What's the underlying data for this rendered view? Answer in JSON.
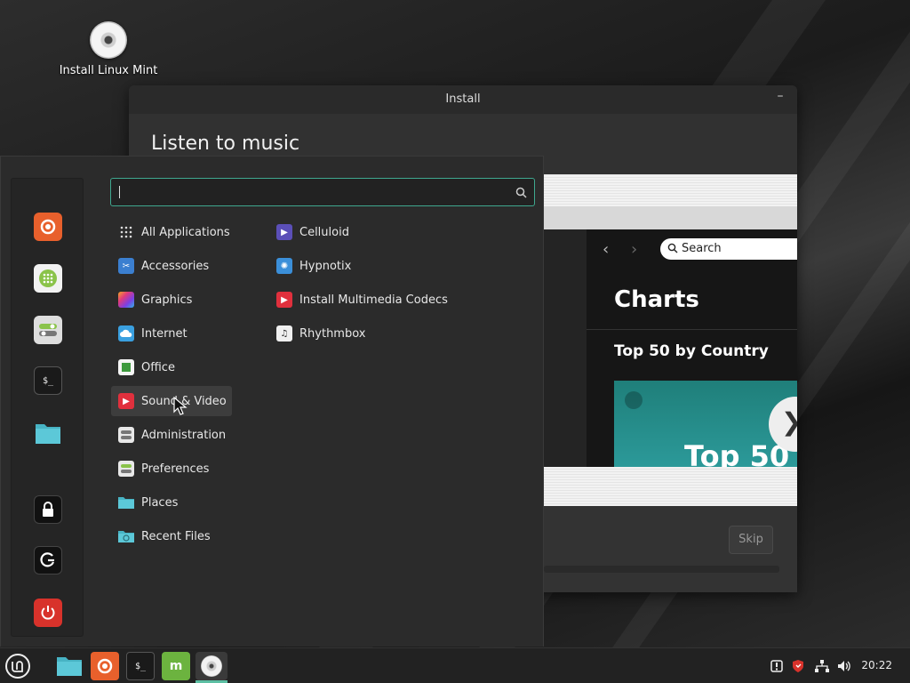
{
  "desktop": {
    "icons": [
      {
        "label": "Install Linux Mint",
        "icon": "disc-icon"
      }
    ]
  },
  "installer": {
    "title": "Install",
    "minimize_label": "–",
    "heading": "Listen to music",
    "slide": {
      "search_placeholder": "Search",
      "charts_title": "Charts",
      "section_title": "Top 50 by Country",
      "card_text": "Top 50",
      "next_glyph": "❯",
      "back_glyph": "‹",
      "forward_glyph": "›"
    },
    "skip_label": "Skip"
  },
  "menu": {
    "search": {
      "value": "",
      "placeholder": ""
    },
    "favorites": [
      {
        "name": "firefox-icon",
        "color": "#e8602c"
      },
      {
        "name": "software-manager-icon",
        "color": "#8ac34a"
      },
      {
        "name": "settings-toggle-icon",
        "color": "#dedede"
      },
      {
        "name": "terminal-icon",
        "color": "#1a1a1a"
      },
      {
        "name": "files-icon",
        "color": "#47b3c4"
      },
      {
        "name": "lock-icon",
        "color": "#111111"
      },
      {
        "name": "logout-icon",
        "color": "#111111"
      },
      {
        "name": "power-icon",
        "color": "#d8322b"
      }
    ],
    "categories": [
      {
        "label": "All Applications",
        "icon": "grid-icon"
      },
      {
        "label": "Accessories",
        "icon": "scissors-icon"
      },
      {
        "label": "Graphics",
        "icon": "graphics-icon"
      },
      {
        "label": "Internet",
        "icon": "cloud-icon"
      },
      {
        "label": "Office",
        "icon": "office-icon"
      },
      {
        "label": "Sound & Video",
        "icon": "play-icon",
        "active": true
      },
      {
        "label": "Administration",
        "icon": "admin-icon"
      },
      {
        "label": "Preferences",
        "icon": "preferences-icon"
      },
      {
        "label": "Places",
        "icon": "folder-icon"
      },
      {
        "label": "Recent Files",
        "icon": "recent-folder-icon"
      }
    ],
    "apps": [
      {
        "label": "Celluloid",
        "icon": "celluloid-icon",
        "color": "#5b4fb8"
      },
      {
        "label": "Hypnotix",
        "icon": "hypnotix-icon",
        "color": "#3b8fd9"
      },
      {
        "label": "Install Multimedia Codecs",
        "icon": "codecs-play-icon",
        "color": "#e0303d"
      },
      {
        "label": "Rhythmbox",
        "icon": "music-note-icon",
        "color": "#f0f0f0"
      }
    ]
  },
  "taskbar": {
    "items": [
      "mint-menu-icon",
      "files-icon",
      "firefox-icon",
      "terminal-icon",
      "mintinstall-icon",
      "installer-disc-icon"
    ],
    "tray": [
      "update-manager-icon",
      "shield-icon",
      "network-icon",
      "volume-icon"
    ],
    "clock": "20:22",
    "accent": "#5cbfa3"
  }
}
